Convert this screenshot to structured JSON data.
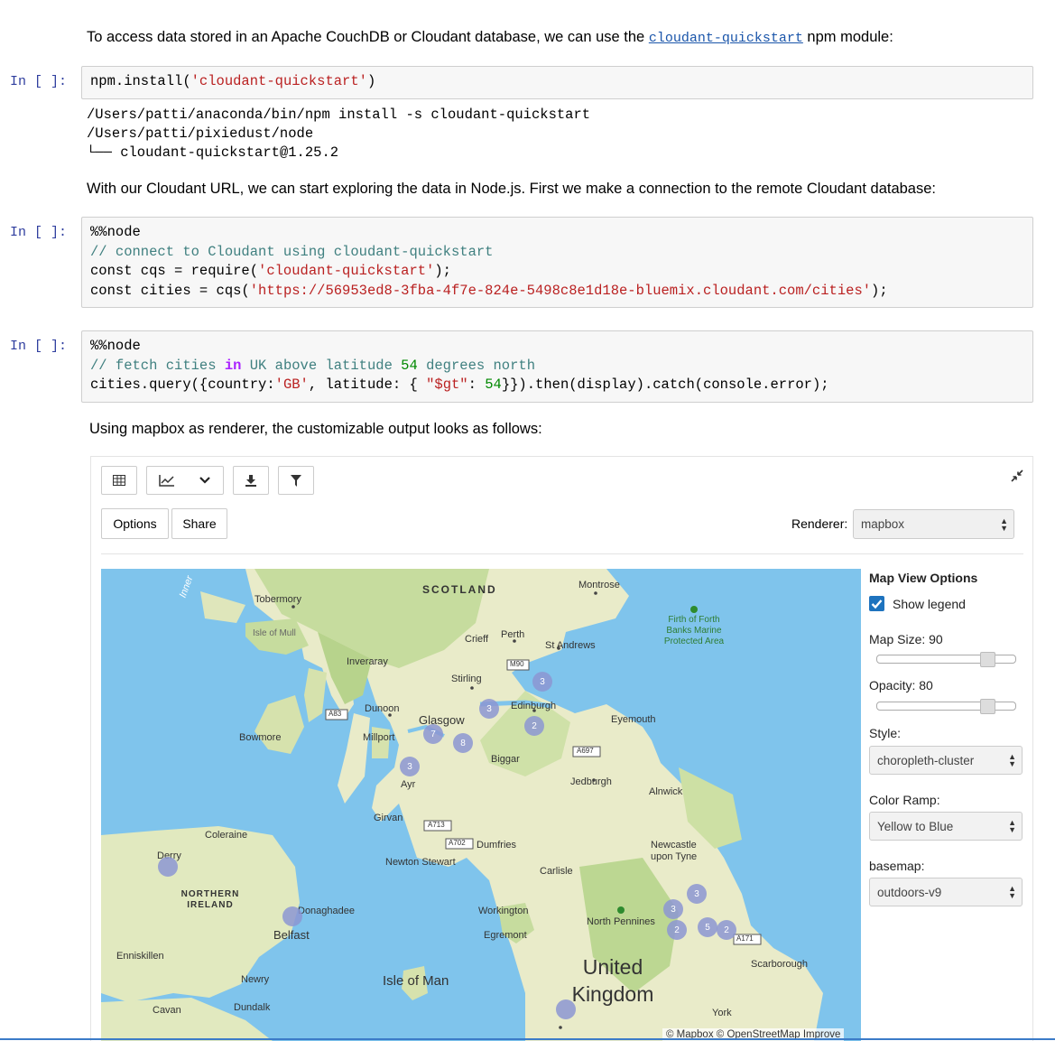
{
  "intro": {
    "text_before": "To access data stored in an Apache CouchDB or Cloudant database, we can use the ",
    "module": "cloudant-quickstart",
    "text_after": " npm module:"
  },
  "cell1": {
    "prompt": "In [ ]:",
    "fn": "npm.install(",
    "arg": "'cloudant-quickstart'",
    "close": ")"
  },
  "output1": [
    "/Users/patti/anaconda/bin/npm install -s cloudant-quickstart",
    "/Users/patti/pixiedust/node",
    "└── cloudant-quickstart@1.25.2"
  ],
  "md2": "With our Cloudant URL, we can start exploring the data in Node.js. First we make a connection to the remote Cloudant database:",
  "cell2": {
    "prompt": "In [ ]:",
    "magic": "%%node",
    "comment": "// connect to Cloudant using cloudant-quickstart",
    "l2a": "const cqs = require(",
    "l2s": "'cloudant-quickstart'",
    "l2b": ");",
    "l3a": "const cities = cqs(",
    "l3s": "'https://56953ed8-3fba-4f7e-824e-5498c8e1d18e-bluemix.cloudant.com/cities'",
    "l3b": ");"
  },
  "cell3": {
    "prompt": "In [ ]:",
    "magic": "%%node",
    "c1": "// fetch cities ",
    "kw": "in",
    "c2": " UK above latitude ",
    "n54": "54",
    "c3": " degrees north",
    "q1": "cities.query({country:",
    "qs1": "'GB'",
    "q2": ", latitude: { ",
    "qs2": "\"$gt\"",
    "q3": ": ",
    "qn": "54",
    "q4": "}}).then(display).catch(console.error);"
  },
  "md3": "Using mapbox as renderer, the customizable output looks as follows:",
  "widget": {
    "options_label": "Options",
    "share_label": "Share",
    "renderer_label": "Renderer:",
    "renderer_value": "mapbox",
    "panel": {
      "title": "Map View Options",
      "show_legend": "Show legend",
      "map_size_label": "Map Size: 90",
      "map_size_value": 90,
      "opacity_label": "Opacity: 80",
      "opacity_value": 80,
      "style_label": "Style:",
      "style_value": "choropleth-cluster",
      "color_ramp_label": "Color Ramp:",
      "color_ramp_value": "Yellow to Blue",
      "basemap_label": "basemap:",
      "basemap_value": "outdoors-v9"
    },
    "map": {
      "attribution": "© Mapbox © OpenStreetMap  Improve",
      "labels": [
        "SCOTLAND",
        "Tobermory",
        "Isle of Mull",
        "Montrose",
        "Perth",
        "Crieff",
        "St Andrews",
        "M90",
        "Inveraray",
        "Stirling",
        "Edinburgh",
        "Dunoon",
        "A83",
        "Glasgow",
        "Millport",
        "Bowmore",
        "Eyemouth",
        "A697",
        "Biggar",
        "Jedburgh",
        "Ayr",
        "Alnwick",
        "Girvan",
        "A713",
        "A702",
        "Dumfries",
        "Coleraine",
        "Derry",
        "Newton Stewart",
        "Carlisle",
        "Newcastle upon Tyne",
        "NORTHERN IRELAND",
        "Donaghadee",
        "Belfast",
        "Workington",
        "Egremont",
        "North Pennines",
        "A171",
        "Enniskillen",
        "Isle of Man",
        "United Kingdom",
        "Scarborough",
        "Newry",
        "Dundalk",
        "Cavan",
        "York",
        "Firth of Forth Banks Marine Protected Area",
        "Inner"
      ],
      "clusters": [
        "3",
        "3",
        "2",
        "7",
        "8",
        "3",
        "3",
        "2",
        "5",
        "2",
        "3"
      ]
    }
  }
}
